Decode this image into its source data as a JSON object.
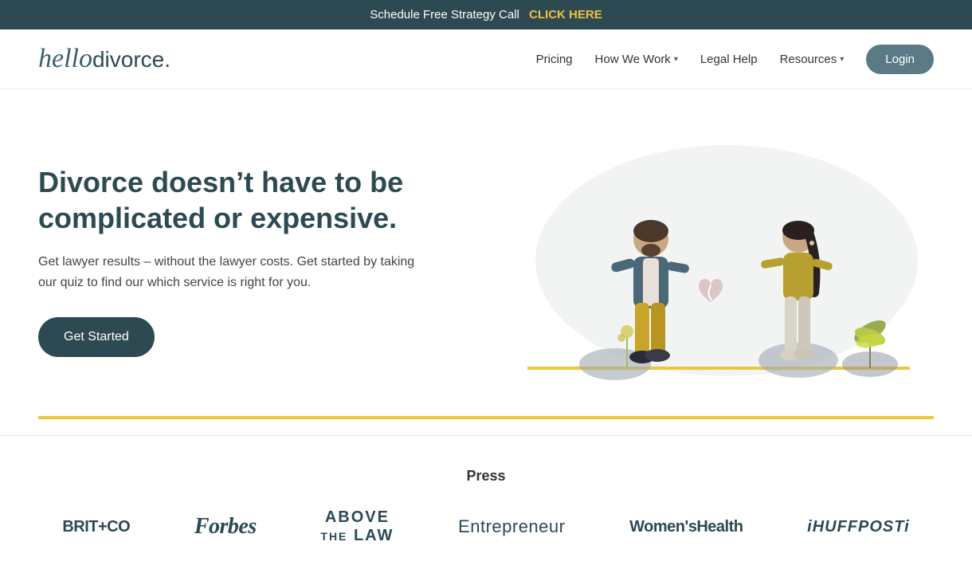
{
  "banner": {
    "text": "Schedule Free Strategy Call",
    "cta": "CLICK HERE"
  },
  "logo": {
    "hello": "hello",
    "divorce": "divorce",
    "dot": "."
  },
  "nav": {
    "pricing": "Pricing",
    "how_we_work": "How We Work",
    "legal_help": "Legal Help",
    "resources": "Resources",
    "login": "Login"
  },
  "hero": {
    "heading": "Divorce doesn’t have to be complicated or expensive.",
    "subtext": "Get lawyer results – without the lawyer costs. Get started by taking our quiz to find our which service is right for you.",
    "cta_button": "Get Started"
  },
  "press": {
    "title": "Press",
    "logos": [
      {
        "name": "BRIT+CO",
        "style": "brit"
      },
      {
        "name": "Forbes",
        "style": "forbes"
      },
      {
        "name": "ABOVE\nTHE LAW",
        "style": "above-law"
      },
      {
        "name": "Entrepreneur",
        "style": "entrepreneur"
      },
      {
        "name": "Women’sHealth",
        "style": "womens-health"
      },
      {
        "name": "iHUFFPOSTi",
        "style": "huffpost"
      }
    ]
  },
  "colors": {
    "brand_dark": "#2d4a52",
    "yellow": "#e8c840",
    "banner_bg": "#2d4a52",
    "cta_yellow": "#f0c040"
  }
}
